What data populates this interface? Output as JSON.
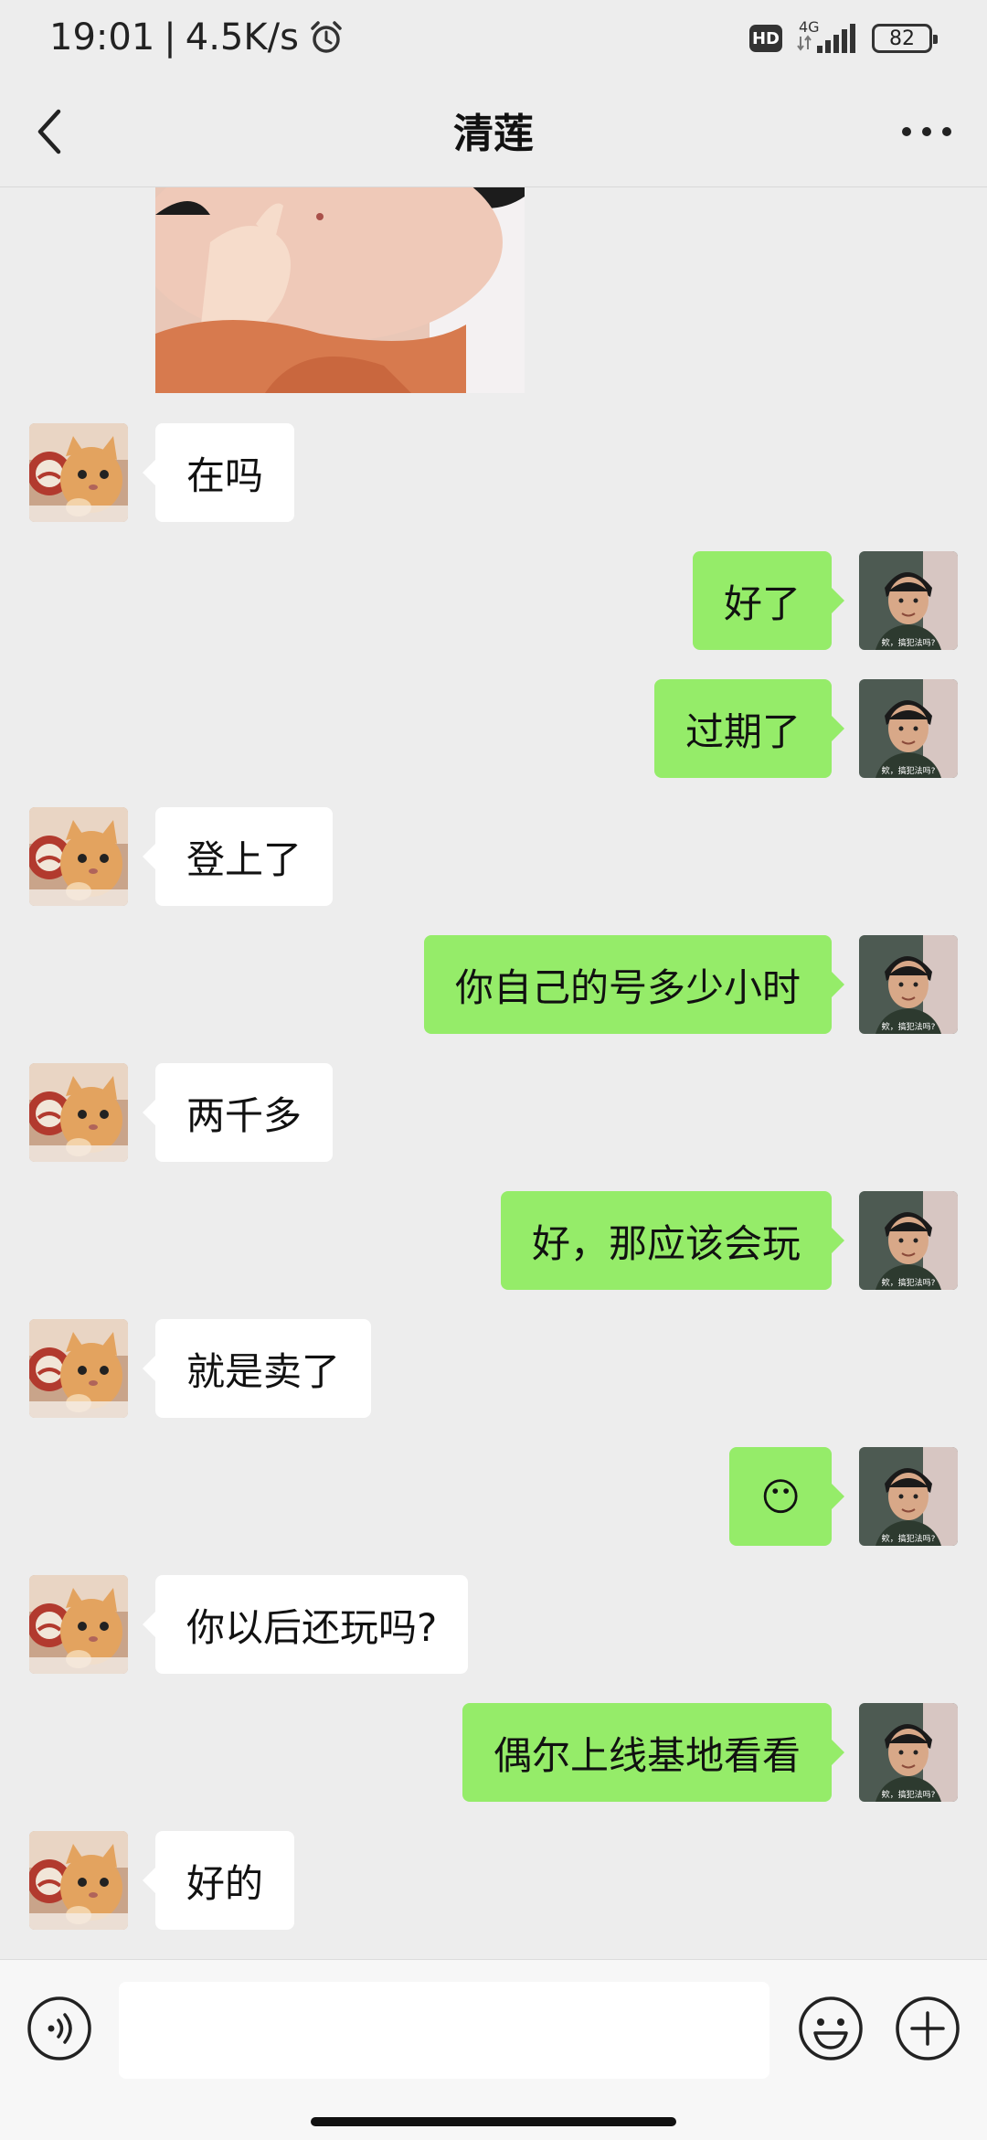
{
  "status_bar": {
    "time": "19:01",
    "separator": "|",
    "net_speed": "4.5K/s",
    "alarm_icon": "alarm-clock-icon",
    "hd_label": "HD",
    "network_type": "4G",
    "battery": "82"
  },
  "header": {
    "back_icon": "chevron-left-icon",
    "title": "清莲",
    "more_icon": "more-dots-icon"
  },
  "messages": [
    {
      "side": "left",
      "text": "在吗"
    },
    {
      "side": "right",
      "text": "好了"
    },
    {
      "side": "right",
      "text": "过期了"
    },
    {
      "side": "left",
      "text": "登上了"
    },
    {
      "side": "right",
      "text": "你自己的号多少小时"
    },
    {
      "side": "left",
      "text": "两千多"
    },
    {
      "side": "right",
      "text": "好，那应该会玩"
    },
    {
      "side": "left",
      "text": "就是卖了"
    },
    {
      "side": "right",
      "text": "😶"
    },
    {
      "side": "left",
      "text": "你以后还玩吗?"
    },
    {
      "side": "right",
      "text": "偶尔上线基地看看"
    },
    {
      "side": "left",
      "text": "好的"
    }
  ],
  "my_avatar_caption": "欸，搞犯法吗?",
  "input": {
    "value": "",
    "voice_icon": "voice-icon",
    "emoji_icon": "emoji-icon",
    "plus_icon": "plus-icon"
  },
  "colors": {
    "background": "#ededed",
    "my_bubble": "#95ec69",
    "their_bubble": "#ffffff"
  }
}
